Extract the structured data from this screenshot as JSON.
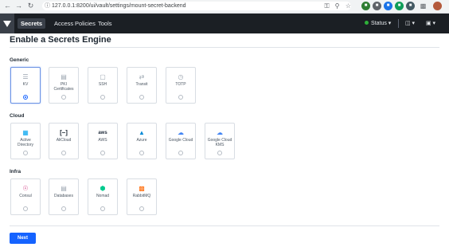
{
  "browser": {
    "url": "127.0.0.1:8200/ui/vault/settings/mount-secret-backend"
  },
  "header": {
    "nav": [
      {
        "label": "Secrets"
      },
      {
        "label": "Access"
      },
      {
        "label": "Policies"
      },
      {
        "label": "Tools"
      }
    ],
    "status_label": "Status"
  },
  "page": {
    "title": "Enable a Secrets Engine",
    "next_label": "Next"
  },
  "sections": [
    {
      "label": "Generic",
      "engines": [
        {
          "label": "KV",
          "icon": "list-icon",
          "selected": true
        },
        {
          "label": "PKI Certificates",
          "icon": "certificate-icon",
          "selected": false
        },
        {
          "label": "SSH",
          "icon": "terminal-icon",
          "selected": false
        },
        {
          "label": "Transit",
          "icon": "transit-icon",
          "selected": false
        },
        {
          "label": "TOTP",
          "icon": "clock-icon",
          "selected": false
        }
      ]
    },
    {
      "label": "Cloud",
      "engines": [
        {
          "label": "Active Directory",
          "icon": "windows-icon",
          "selected": false
        },
        {
          "label": "AliCloud",
          "icon": "alicloud-icon",
          "selected": false
        },
        {
          "label": "AWS",
          "icon": "aws-icon",
          "selected": false
        },
        {
          "label": "Azure",
          "icon": "azure-icon",
          "selected": false
        },
        {
          "label": "Google Cloud",
          "icon": "google-cloud-icon",
          "selected": false
        },
        {
          "label": "Google Cloud KMS",
          "icon": "google-cloud-icon",
          "selected": false
        }
      ]
    },
    {
      "label": "Infra",
      "engines": [
        {
          "label": "Consul",
          "icon": "consul-icon",
          "selected": false
        },
        {
          "label": "Databases",
          "icon": "database-icon",
          "selected": false
        },
        {
          "label": "Nomad",
          "icon": "nomad-icon",
          "selected": false
        },
        {
          "label": "RabbitMQ",
          "icon": "rabbitmq-icon",
          "selected": false
        }
      ]
    }
  ],
  "colors": {
    "accent": "#1563ff",
    "header_bg": "#1b1f24",
    "status_ok": "#2eb039"
  }
}
